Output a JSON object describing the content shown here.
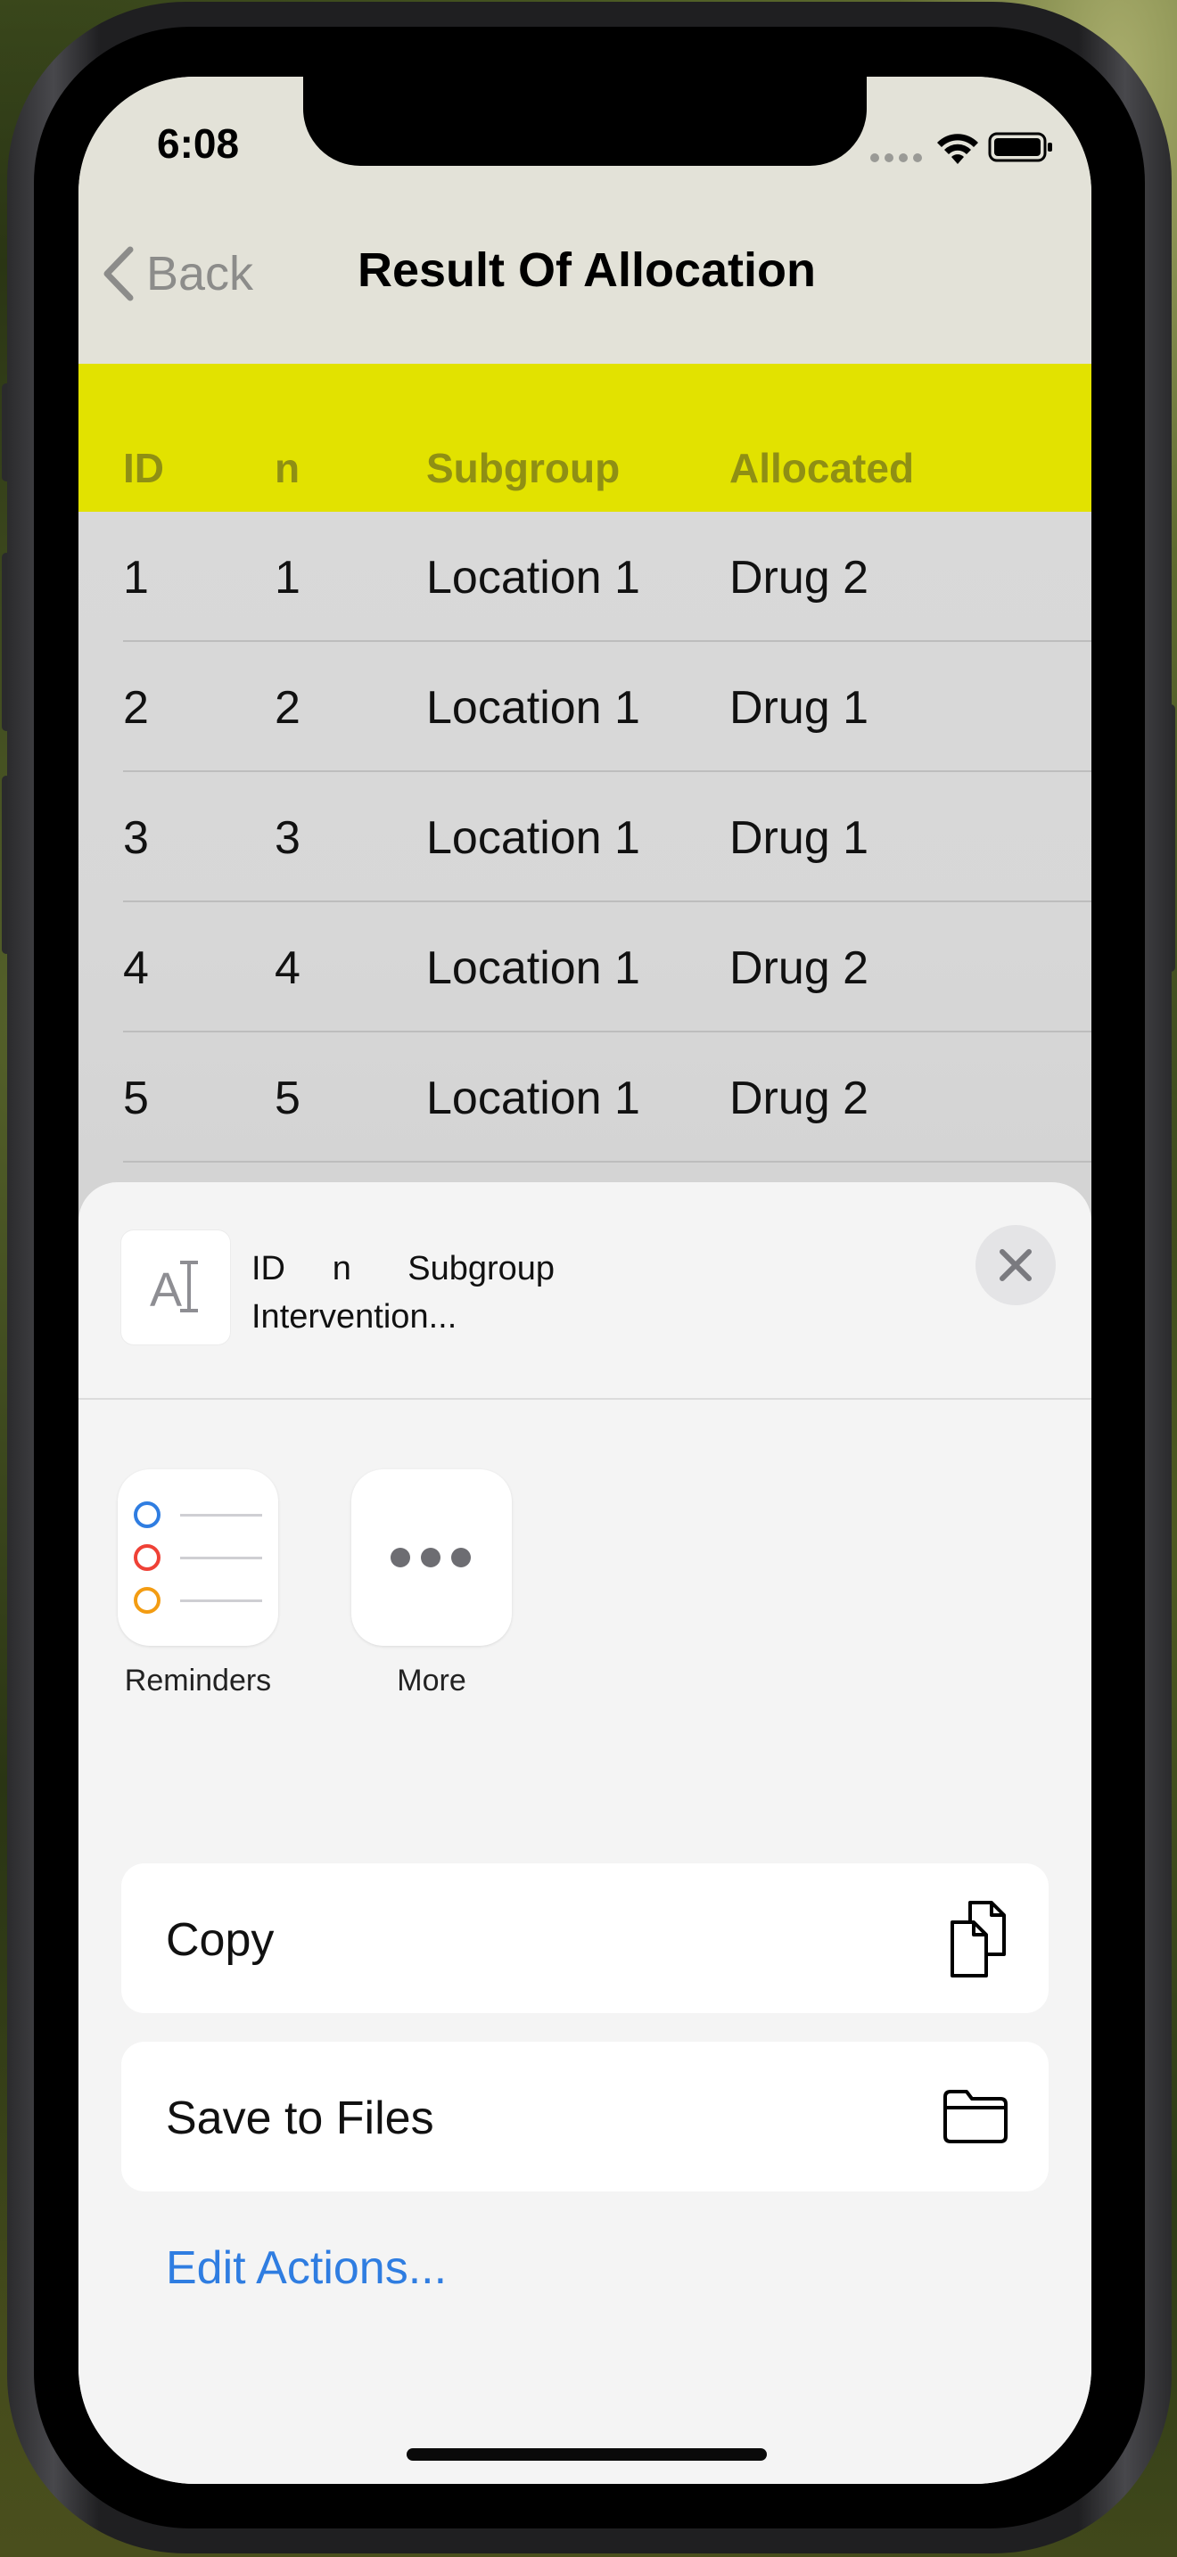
{
  "status_bar": {
    "time": "6:08"
  },
  "nav": {
    "back_label": "Back",
    "title": "Result Of Allocation"
  },
  "table": {
    "header_color": "#e2e200",
    "columns": [
      "ID",
      "n",
      "Subgroup",
      "Allocated"
    ],
    "rows": [
      [
        "1",
        "1",
        "Location 1",
        "Drug 2"
      ],
      [
        "2",
        "2",
        "Location 1",
        "Drug 1"
      ],
      [
        "3",
        "3",
        "Location 1",
        "Drug 1"
      ],
      [
        "4",
        "4",
        "Location 1",
        "Drug 2"
      ],
      [
        "5",
        "5",
        "Location 1",
        "Drug 2"
      ]
    ]
  },
  "share_sheet": {
    "preview_line1": "ID     n      Subgroup",
    "preview_line2": "Intervention...",
    "apps": [
      {
        "label": "Reminders",
        "icon": "reminders-icon"
      },
      {
        "label": "More",
        "icon": "more-icon"
      }
    ],
    "actions": [
      {
        "label": "Copy",
        "icon": "copy-icon"
      },
      {
        "label": "Save to Files",
        "icon": "folder-icon"
      }
    ],
    "edit_actions_label": "Edit Actions...",
    "accent_color": "#2f7de1"
  }
}
